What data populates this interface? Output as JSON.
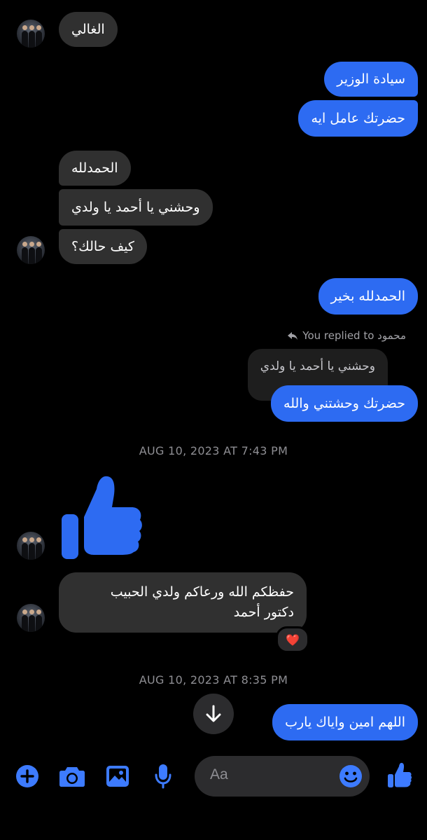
{
  "messages": {
    "m1": "الغالي",
    "m2": "سيادة الوزير",
    "m3": "حضرتك عامل ايه",
    "m4": "الحمدلله",
    "m5": "وحشني  يا أحمد  يا ولدي",
    "m6": "كيف حالك؟",
    "m7": "الحمدلله بخير",
    "reply_header": "You replied to محمود",
    "quoted": "وحشني  يا أحمد  يا ولدي",
    "m8": "حضرتك وحشتني والله",
    "m10_line1": "حفظكم الله ورعاكم ولدي الحبيب",
    "m10_line2": "دكتور أحمد",
    "reaction": "❤️",
    "m11": "اللهم امين واياك يارب"
  },
  "timestamps": {
    "t1": "AUG 10, 2023 AT 7:43 PM",
    "t2": "AUG 10, 2023 AT 8:35 PM"
  },
  "composer": {
    "placeholder": "Aa"
  },
  "colors": {
    "accent": "#2d6bf2",
    "icon_blue": "#3d7bff",
    "incoming_bubble": "#303030",
    "background": "#000000"
  }
}
